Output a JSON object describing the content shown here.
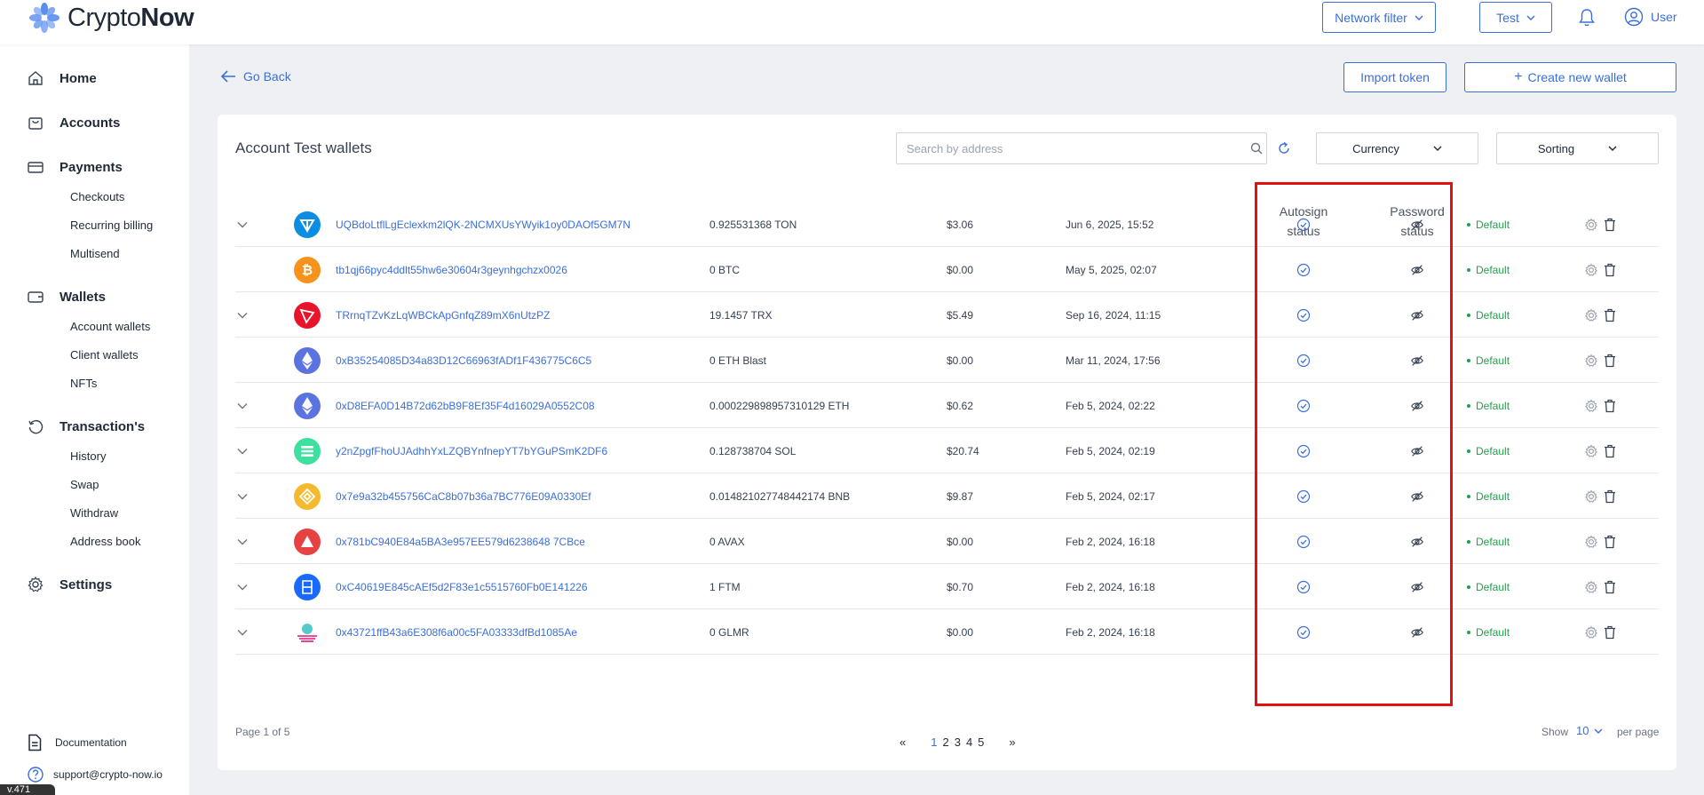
{
  "app": {
    "brand_prefix": "Crypto",
    "brand_suffix": "Now",
    "accent_color": "#3b6fd8"
  },
  "header": {
    "network_filter_label": "Network filter",
    "account_selector_label": "Test",
    "user_label": "User"
  },
  "sidebar": {
    "home": "Home",
    "accounts": "Accounts",
    "payments": "Payments",
    "payments_items": [
      "Checkouts",
      "Recurring billing",
      "Multisend"
    ],
    "wallets": "Wallets",
    "wallets_items": [
      "Account wallets",
      "Client wallets",
      "NFTs"
    ],
    "transactions": "Transaction's",
    "transactions_items": [
      "History",
      "Swap",
      "Withdraw",
      "Address book"
    ],
    "settings": "Settings",
    "documentation": "Documentation",
    "support_email": "support@crypto-now.io",
    "version_tag": "v.471"
  },
  "actions": {
    "go_back": "Go Back",
    "import_token": "Import token",
    "create_wallet": "Create new wallet"
  },
  "card": {
    "title": "Account Test wallets",
    "search_placeholder": "Search by address",
    "search_value": "",
    "currency_label": "Currency",
    "sorting_label": "Sorting",
    "col_autosign_1": "Autosign",
    "col_autosign_2": "status",
    "col_password_1": "Password",
    "col_password_2": "status"
  },
  "wallets": [
    {
      "address": "UQBdoLtflLgEclexkm2lQK-2NCMXUsYWyik1oy0DAOf5GM7N",
      "balance": "0.925531368 TON",
      "usd": "$3.06",
      "date": "Jun 6, 2025, 15:52",
      "status": "Default",
      "expandable": true,
      "token_icon": "ton-icon",
      "token_color": "#0b8de3"
    },
    {
      "address": "tb1qj66pyc4ddlt55hw6e30604r3geynhgchzx0026",
      "balance": "0 BTC",
      "usd": "$0.00",
      "date": "May 5, 2025, 02:07",
      "status": "Default",
      "expandable": false,
      "token_icon": "bitcoin-icon",
      "token_color": "#f7931a"
    },
    {
      "address": "TRrnqTZvKzLqWBCkApGnfqZ89mX6nUtzPZ",
      "balance": "19.1457 TRX",
      "usd": "$5.49",
      "date": "Sep 16, 2024, 11:15",
      "status": "Default",
      "expandable": true,
      "token_icon": "tron-icon",
      "token_color": "#e8142a"
    },
    {
      "address": "0xB35254085D34a83D12C66963fADf1F436775C6C5",
      "balance": "0 ETH Blast",
      "usd": "$0.00",
      "date": "Mar 11, 2024, 17:56",
      "status": "Default",
      "expandable": false,
      "token_icon": "ethereum-icon",
      "token_color": "#5b73e0"
    },
    {
      "address": "0xD8EFA0D14B72d62bB9F8Ef35F4d16029A0552C08",
      "balance": "0.000229898957310129 ETH",
      "usd": "$0.62",
      "date": "Feb 5, 2024, 02:22",
      "status": "Default",
      "expandable": true,
      "token_icon": "ethereum-icon",
      "token_color": "#5b73e0"
    },
    {
      "address": "y2nZpgfFhoUJAdhhYxLZQBYnfnepYT7bYGuPSmK2DF6",
      "balance": "0.128738704 SOL",
      "usd": "$20.74",
      "date": "Feb 5, 2024, 02:19",
      "status": "Default",
      "expandable": true,
      "token_icon": "solana-icon",
      "token_color": "#3ee0a0"
    },
    {
      "address": "0x7e9a32b455756CaC8b07b36a7BC776E09A0330Ef",
      "balance": "0.014821027748442174 BNB",
      "usd": "$9.87",
      "date": "Feb 5, 2024, 02:17",
      "status": "Default",
      "expandable": true,
      "token_icon": "bnb-icon",
      "token_color": "#f3ba2f"
    },
    {
      "address": "0x781bC940E84a5BA3e957EE579d6238648 7CBce",
      "balance": "0 AVAX",
      "usd": "$0.00",
      "date": "Feb 2, 2024, 16:18",
      "status": "Default",
      "expandable": true,
      "token_icon": "avalanche-icon",
      "token_color": "#e84142"
    },
    {
      "address": "0xC40619E845cAEf5d2F83e1c5515760Fb0E141226",
      "balance": "1 FTM",
      "usd": "$0.70",
      "date": "Feb 2, 2024, 16:18",
      "status": "Default",
      "expandable": true,
      "token_icon": "fantom-icon",
      "token_color": "#1969ff"
    },
    {
      "address": "0x43721ffB43a6E308f6a00c5FA03333dfBd1085Ae",
      "balance": "0 GLMR",
      "usd": "$0.00",
      "date": "Feb 2, 2024, 16:18",
      "status": "Default",
      "expandable": true,
      "token_icon": "moonbeam-icon",
      "token_color": "#53cbc9"
    }
  ],
  "pagination": {
    "info": "Page 1 of 5",
    "prev": "«",
    "pages": [
      "1",
      "2",
      "3",
      "4",
      "5"
    ],
    "next": "»",
    "show_label": "Show",
    "per_page_value": "10",
    "per_page_label": "per page"
  }
}
